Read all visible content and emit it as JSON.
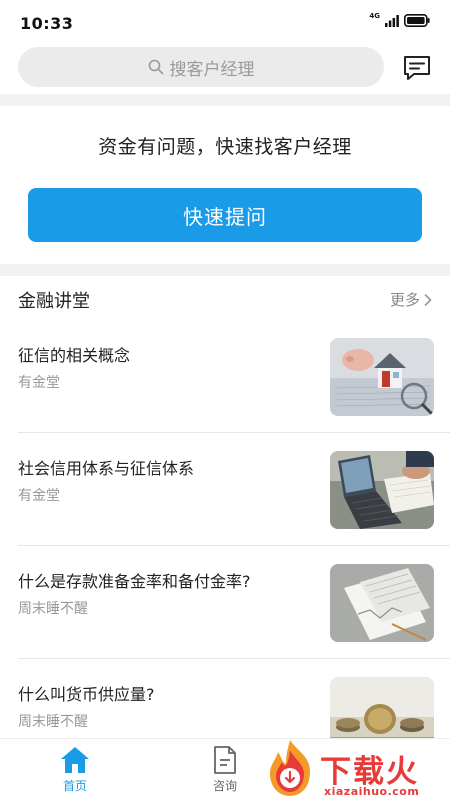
{
  "status_bar": {
    "time": "10:33",
    "network": "4G"
  },
  "search": {
    "placeholder": "搜客户经理"
  },
  "quick_ask": {
    "headline": "资金有问题，快速找客户经理",
    "button_label": "快速提问"
  },
  "finance_lecture": {
    "title": "金融讲堂",
    "more_label": "更多",
    "articles": [
      {
        "title": "征信的相关概念",
        "author": "有金堂"
      },
      {
        "title": "社会信用体系与征信体系",
        "author": "有金堂"
      },
      {
        "title": "什么是存款准备金率和备付金率?",
        "author": "周末睡不醒"
      },
      {
        "title": "什么叫货币供应量?",
        "author": "周末睡不醒"
      }
    ]
  },
  "tab_bar": {
    "tabs": [
      {
        "label": "首页",
        "icon": "home-icon",
        "active": true
      },
      {
        "label": "咨询",
        "icon": "document-icon",
        "active": false
      }
    ]
  },
  "watermark": {
    "text": "下载火",
    "subtext": "xiazaihuo.com"
  },
  "colors": {
    "accent": "#1a9be8",
    "watermark": "#e93a3a",
    "divider": "#e6e6e6"
  }
}
